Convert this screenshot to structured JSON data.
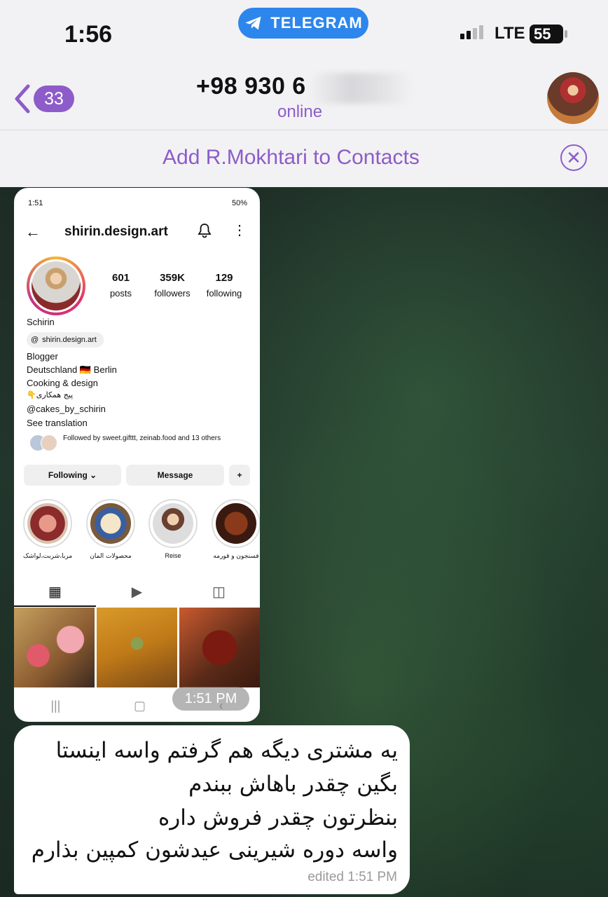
{
  "status_bar": {
    "time": "1:56",
    "app_pill": "TELEGRAM",
    "network": "LTE",
    "battery": "55"
  },
  "nav": {
    "unread_count": "33",
    "title": "+98 930 6",
    "subtitle": "online"
  },
  "add_contact": {
    "label": "Add R.Mokhtari to Contacts"
  },
  "screenshot": {
    "phone_time": "1:51",
    "phone_status": "50%",
    "username": "shirin.design.art",
    "stats": [
      {
        "value": "601",
        "label": "posts"
      },
      {
        "value": "359K",
        "label": "followers"
      },
      {
        "value": "129",
        "label": "following"
      }
    ],
    "name": "Schirin",
    "threads_handle": "shirin.design.art",
    "bio": [
      "Blogger",
      "Deutschland 🇩🇪 Berlin",
      "Cooking & design",
      "👇پیج همکاری",
      "@cakes_by_schirin",
      "See translation"
    ],
    "followed_by": "Followed by sweet.gifttt, zeinab.food and 13 others",
    "buttons": {
      "following": "Following ⌄",
      "message": "Message"
    },
    "highlights": [
      "مربا،شربت،لواشک",
      "محصولات المان",
      "Reise",
      "فسنجون و قورمه"
    ],
    "timestamp": "1:51 PM"
  },
  "message": {
    "lines": [
      "یه مشتری دیگه هم گرفتم واسه اینستا",
      " بگین چقدر باهاش ببندم",
      "بنظرتون چقدر فروش داره",
      "واسه دوره شیرینی عیدشون کمپین بذارم"
    ],
    "meta": "edited 1:51 PM"
  },
  "colors": {
    "accent": "#8d5cc9",
    "telegram_blue": "#2d86ec"
  }
}
